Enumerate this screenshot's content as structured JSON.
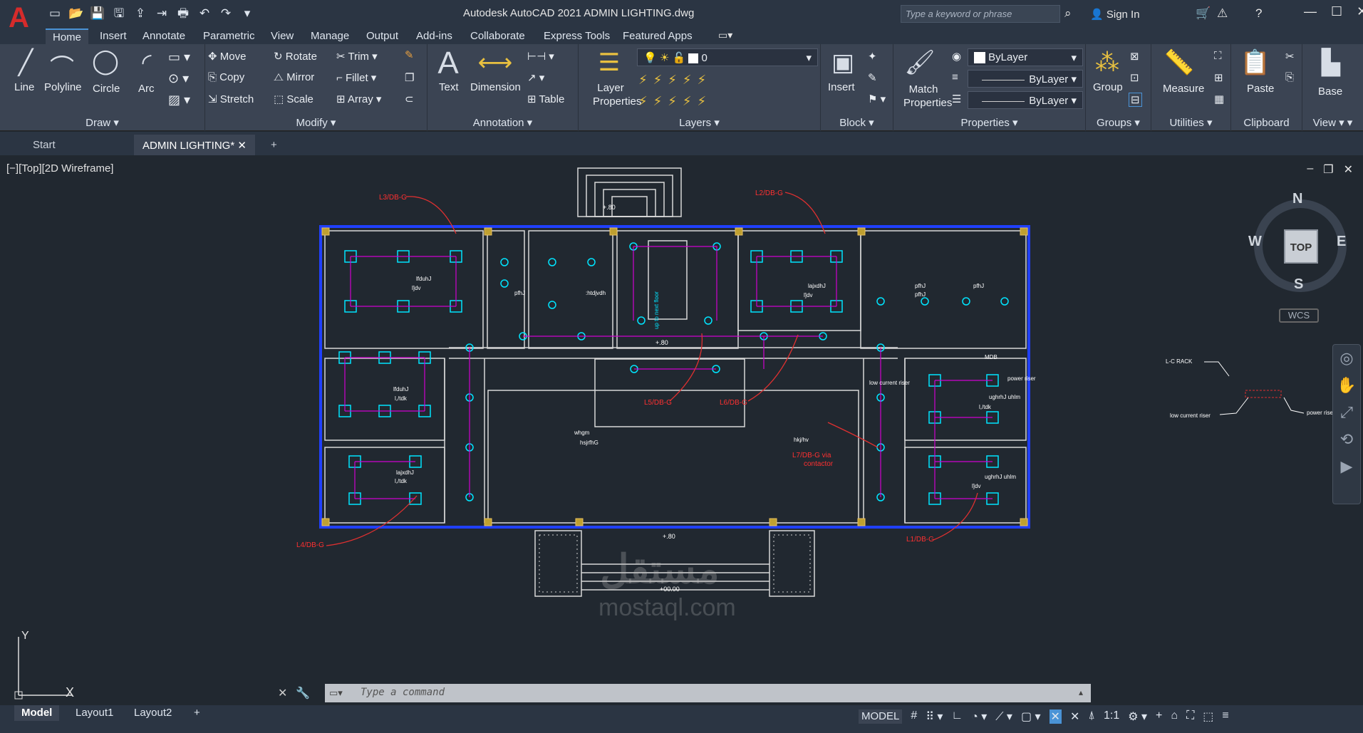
{
  "app": {
    "title": "Autodesk AutoCAD 2021    ADMIN LIGHTING.dwg",
    "logo_letter": "A"
  },
  "search": {
    "placeholder": "Type a keyword or phrase"
  },
  "account": {
    "signin": "Sign In"
  },
  "menu_tabs": [
    "Home",
    "Insert",
    "Annotate",
    "Parametric",
    "View",
    "Manage",
    "Output",
    "Add-ins",
    "Collaborate",
    "Express Tools",
    "Featured Apps"
  ],
  "ribbon": {
    "draw": {
      "title": "Draw",
      "line": "Line",
      "polyline": "Polyline",
      "circle": "Circle",
      "arc": "Arc"
    },
    "modify": {
      "title": "Modify",
      "move": "Move",
      "rotate": "Rotate",
      "trim": "Trim",
      "copy": "Copy",
      "mirror": "Mirror",
      "fillet": "Fillet",
      "stretch": "Stretch",
      "scale": "Scale",
      "array": "Array"
    },
    "annotation": {
      "title": "Annotation",
      "text": "Text",
      "dimension": "Dimension",
      "table": "Table"
    },
    "layers": {
      "title": "Layers",
      "layer_properties": "Layer Properties",
      "current_layer": "0"
    },
    "block": {
      "title": "Block",
      "insert": "Insert"
    },
    "properties": {
      "title": "Properties",
      "match": "Match Properties",
      "color": "ByLayer",
      "linetype": "ByLayer",
      "lineweight": "ByLayer"
    },
    "groups": {
      "title": "Groups",
      "group": "Group"
    },
    "utilities": {
      "title": "Utilities",
      "measure": "Measure"
    },
    "clipboard": {
      "title": "Clipboard",
      "paste": "Paste"
    },
    "view": {
      "title": "View",
      "base": "Base"
    }
  },
  "doc_tabs": {
    "start": "Start",
    "active": "ADMIN LIGHTING*"
  },
  "viewport": {
    "label": "[−][Top][2D Wireframe]",
    "compass": {
      "n": "N",
      "s": "S",
      "e": "E",
      "w": "W",
      "top": "TOP"
    },
    "wcs": "WCS",
    "axis_x": "X",
    "axis_y": "Y"
  },
  "drawing": {
    "labels": {
      "l3": "L3/DB-G",
      "l2": "L2/DB-G",
      "l5": "L5/DB-G",
      "l6": "L6/DB-G",
      "l4": "L4/DB-G",
      "l1": "L1/DB-G",
      "l7": "L7/DB-G via",
      "contactor": "contactor",
      "lc_rack": "L-C RACK",
      "low_current_riser": "low current riser",
      "power_riser": "power riser",
      "lcr_in": "low current riser",
      "pr_in": "power riser",
      "mdb": "MDB",
      "lvl1": "+.80",
      "lvl2": "+.80",
      "lvl3": "+.80",
      "lvl4": "+00.00",
      "rm1a": "lfduhJ",
      "rm1b": "l]dv",
      "rm2a": "lajxdhJ",
      "rm2b": "l]dv",
      "rm3a": "lfduhJ",
      "rm3b": "l,/tdk",
      "rm4a": "lajxdhJ",
      "rm4b": "l,/tdk",
      "rm5a": "whgm",
      "rm5b": "hsjrfhG",
      "rm6": "hkj/hv",
      "rm7a": "ughrhJ uhlm",
      "rm7b": "l,/tdk",
      "rm8a": "ughrhJ uhlm",
      "rm8b": "l]dv",
      "rm9": ":htdjvdh",
      "wc1": "pfhJ",
      "wc2": "pfhJ",
      "wc3": "pfhJ",
      "wc4": "pfhJ",
      "stair": "up to next floor"
    }
  },
  "command": {
    "placeholder": "Type  a  command"
  },
  "status": {
    "model_tab": "Model",
    "layout1": "Layout1",
    "layout2": "Layout2",
    "model_btn": "MODEL",
    "scale": "1:1"
  },
  "watermark": {
    "ar": "مستقل",
    "en": "mostaql.com"
  },
  "colors": {
    "accent": "#4a93d6",
    "wall": "#0000ff",
    "fixture": "#00e5ff",
    "wire": "#d000d0",
    "tag": "#ff2020"
  }
}
